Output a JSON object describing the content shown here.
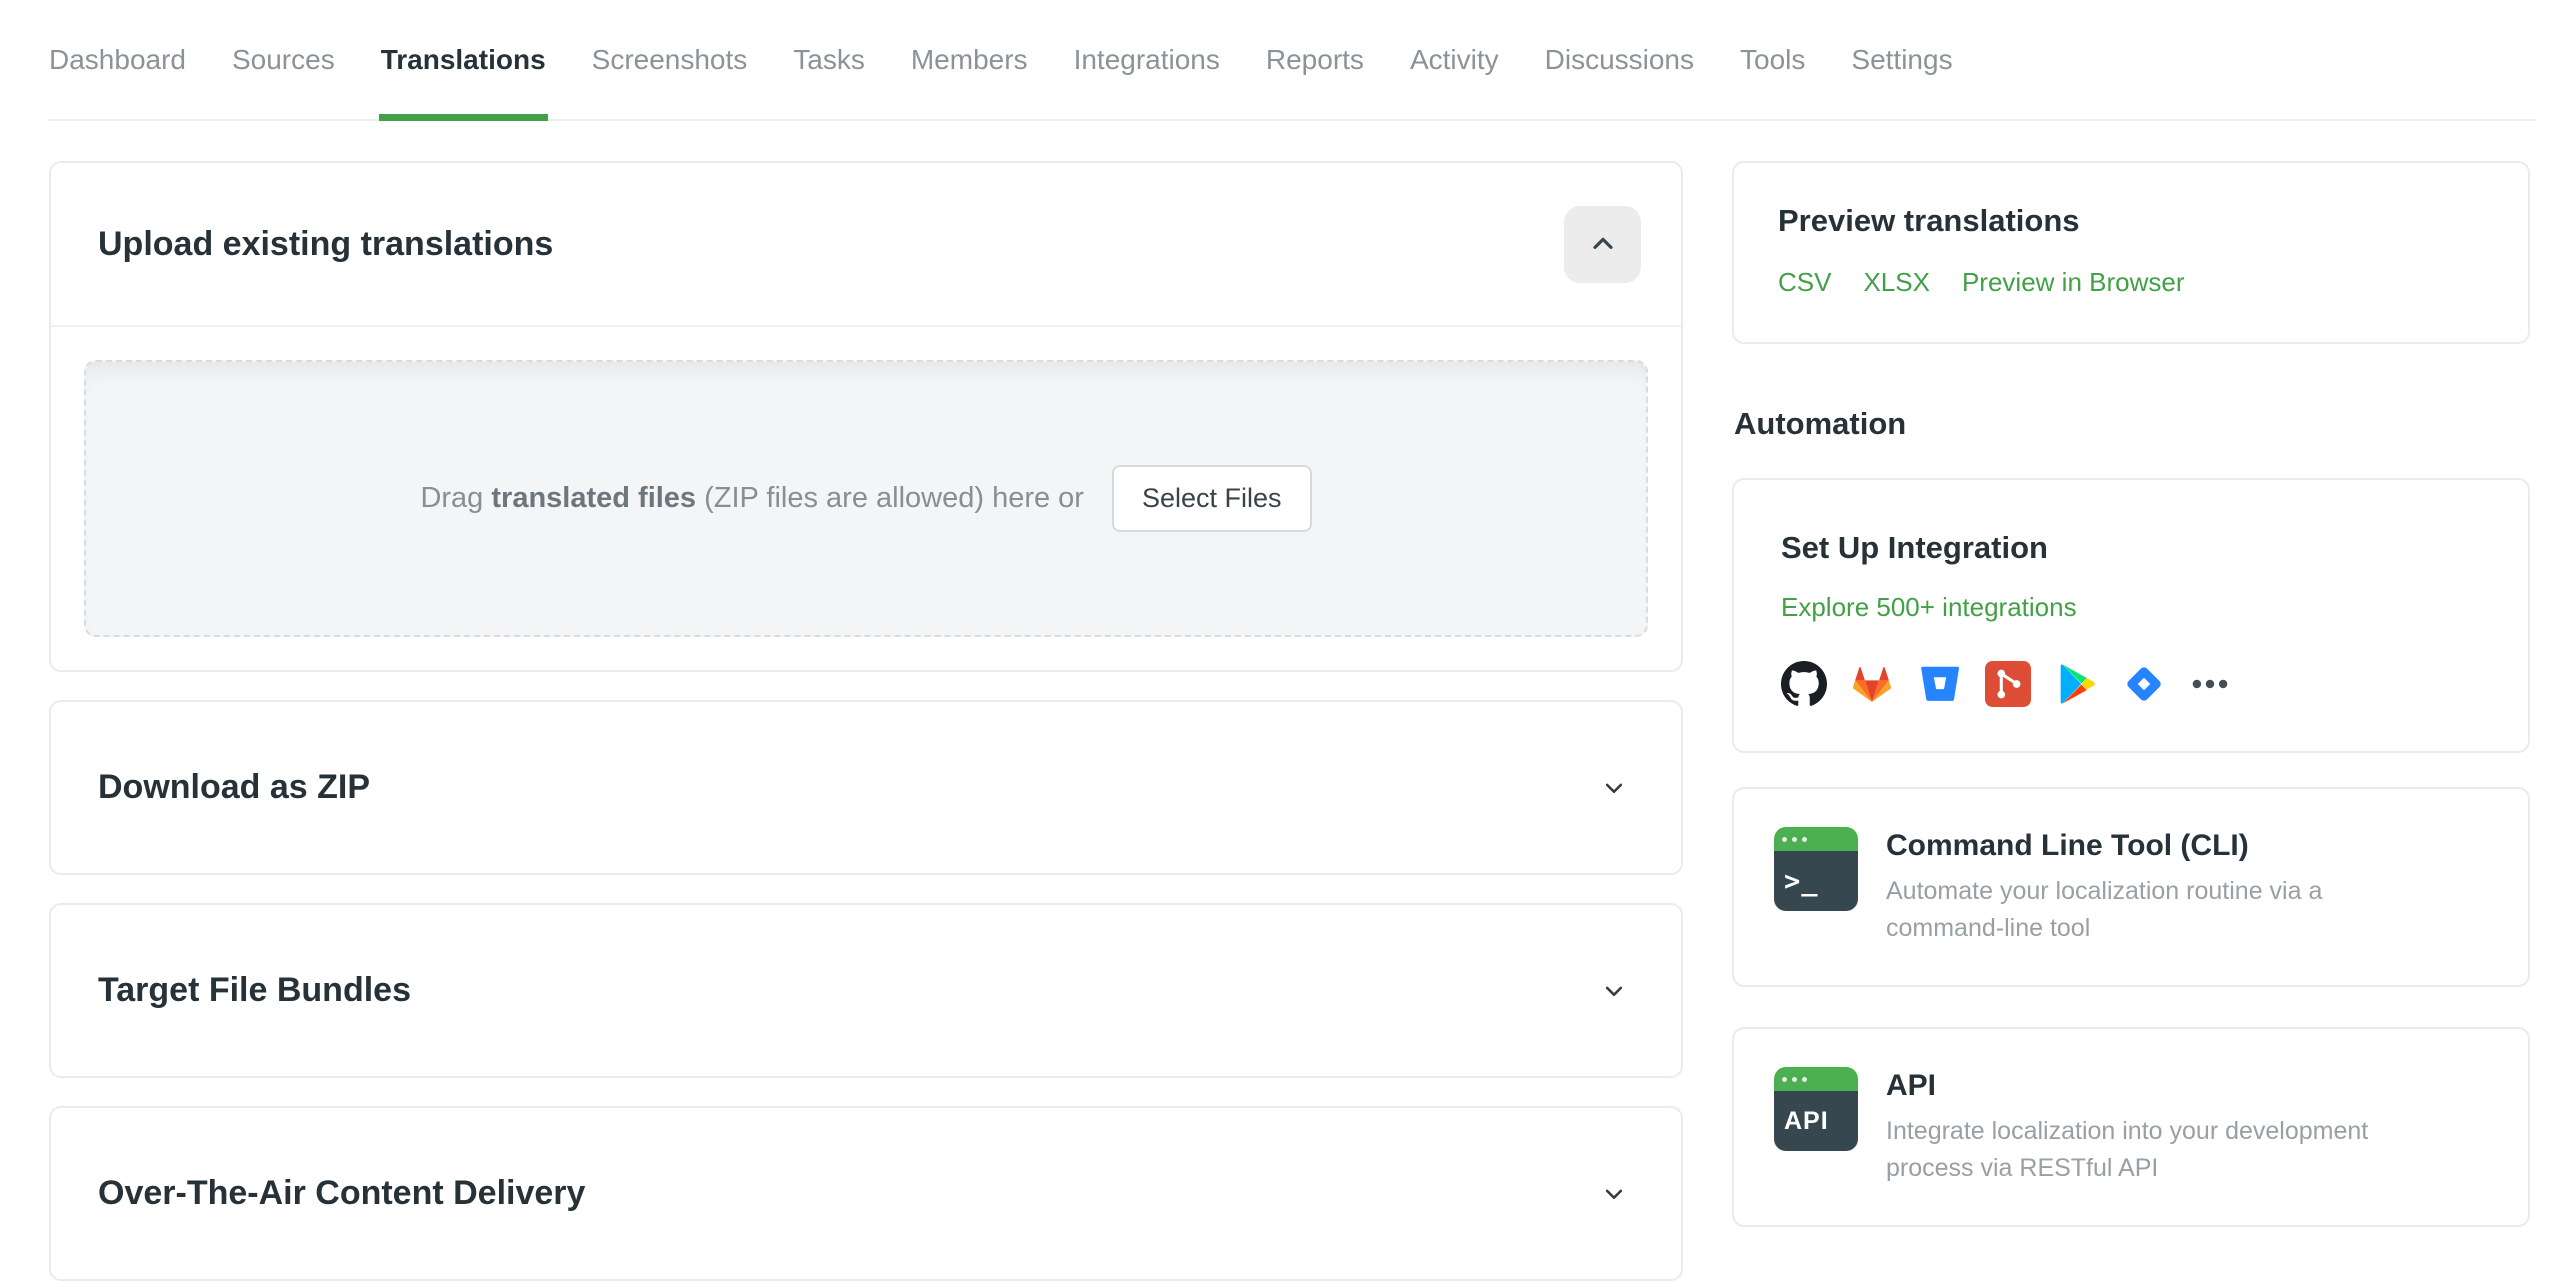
{
  "nav": {
    "items": [
      {
        "label": "Dashboard",
        "active": false
      },
      {
        "label": "Sources",
        "active": false
      },
      {
        "label": "Translations",
        "active": true
      },
      {
        "label": "Screenshots",
        "active": false
      },
      {
        "label": "Tasks",
        "active": false
      },
      {
        "label": "Members",
        "active": false
      },
      {
        "label": "Integrations",
        "active": false
      },
      {
        "label": "Reports",
        "active": false
      },
      {
        "label": "Activity",
        "active": false
      },
      {
        "label": "Discussions",
        "active": false
      },
      {
        "label": "Tools",
        "active": false
      },
      {
        "label": "Settings",
        "active": false
      }
    ]
  },
  "upload_panel": {
    "title": "Upload existing translations",
    "collapse_icon": "chevron-up",
    "dropzone": {
      "text_prefix": "Drag ",
      "text_bold": "translated files",
      "text_suffix": " (ZIP files are allowed) here or",
      "button_label": "Select Files"
    }
  },
  "collapsed_panels": [
    {
      "title": "Download as ZIP",
      "state_icon": "chevron-down"
    },
    {
      "title": "Target File Bundles",
      "state_icon": "chevron-down"
    },
    {
      "title": "Over-The-Air Content Delivery",
      "state_icon": "chevron-down"
    }
  ],
  "sidebar": {
    "preview": {
      "title": "Preview translations",
      "links": [
        {
          "label": "CSV"
        },
        {
          "label": "XLSX"
        },
        {
          "label": "Preview in Browser"
        }
      ]
    },
    "automation_heading": "Automation",
    "integration_card": {
      "title": "Set Up Integration",
      "link": "Explore 500+ integrations",
      "icons": [
        "github",
        "gitlab",
        "bitbucket",
        "git",
        "google-play",
        "jira",
        "more"
      ]
    },
    "cli_card": {
      "title": "Command Line Tool (CLI)",
      "description": "Automate your localization routine via a command-line tool",
      "icon_text": ">_"
    },
    "api_card": {
      "title": "API",
      "description": "Integrate localization into your development process via RESTful API",
      "icon_text": "API"
    }
  },
  "colors": {
    "accent_green": "#43a047",
    "heading": "#263238",
    "nav_inactive": "#8b9398",
    "muted_text": "#98a0a5"
  }
}
